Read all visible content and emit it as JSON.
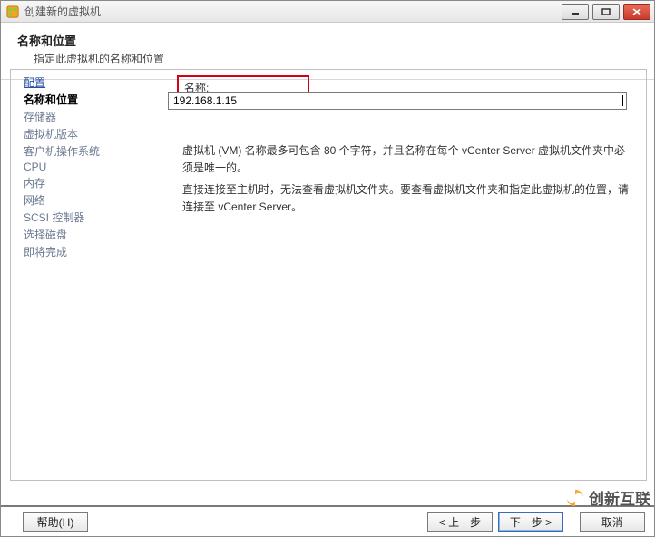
{
  "window": {
    "title": "创建新的虚拟机"
  },
  "header": {
    "title": "名称和位置",
    "subtitle": "指定此虚拟机的名称和位置"
  },
  "steps": [
    {
      "label": "配置",
      "state": "link"
    },
    {
      "label": "名称和位置",
      "state": "current"
    },
    {
      "label": "存储器",
      "state": "pending"
    },
    {
      "label": "虚拟机版本",
      "state": "pending"
    },
    {
      "label": "客户机操作系统",
      "state": "pending"
    },
    {
      "label": "CPU",
      "state": "pending"
    },
    {
      "label": "内存",
      "state": "pending"
    },
    {
      "label": "网络",
      "state": "pending"
    },
    {
      "label": "SCSI 控制器",
      "state": "pending"
    },
    {
      "label": "选择磁盘",
      "state": "pending"
    },
    {
      "label": "即将完成",
      "state": "pending"
    }
  ],
  "main": {
    "name_label": "名称:",
    "name_value": "192.168.1.15",
    "help1": "虚拟机 (VM) 名称最多可包含 80 个字符，并且名称在每个 vCenter Server 虚拟机文件夹中必须是唯一的。",
    "help2": "直接连接至主机时，无法查看虚拟机文件夹。要查看虚拟机文件夹和指定此虚拟机的位置，请连接至 vCenter Server。"
  },
  "footer": {
    "help": "帮助(H)",
    "back": "< 上一步",
    "next": "下一步 >",
    "cancel": "取消"
  },
  "watermark": {
    "text": "创新互联"
  }
}
